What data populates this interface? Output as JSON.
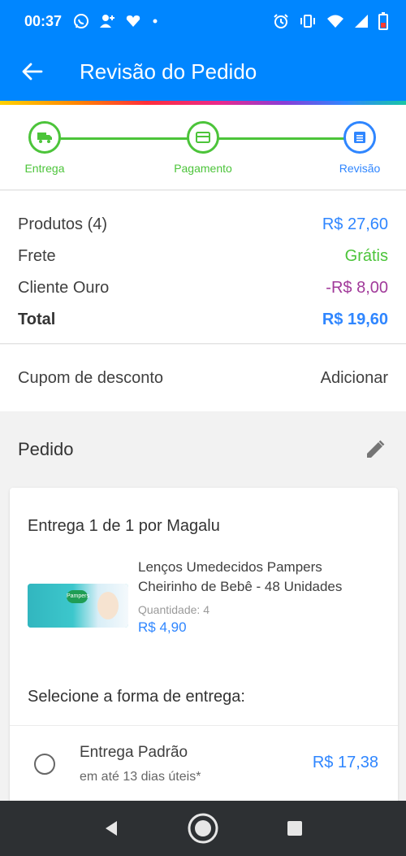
{
  "status_bar": {
    "time": "00:37",
    "left_icons": [
      "whatsapp-icon",
      "contacts-icon",
      "heart-icon",
      "dot-icon"
    ],
    "right_icons": [
      "alarm-icon",
      "vibrate-icon",
      "wifi-icon",
      "signal-icon",
      "battery-icon"
    ]
  },
  "app_bar": {
    "title": "Revisão do Pedido",
    "back_icon": "arrow-left-icon",
    "color": "#0086ff"
  },
  "stepper": {
    "steps": [
      {
        "label": "Entrega",
        "icon": "truck-icon",
        "state": "done"
      },
      {
        "label": "Pagamento",
        "icon": "card-icon",
        "state": "done"
      },
      {
        "label": "Revisão",
        "icon": "list-icon",
        "state": "active"
      }
    ],
    "done_color": "#4cc43a",
    "active_color": "#2f86ff"
  },
  "summary": {
    "products_label": "Produtos (4)",
    "products_value": "R$ 27,60",
    "shipping_label": "Frete",
    "shipping_value": "Grátis",
    "gold_label": "Cliente Ouro",
    "gold_value": "-R$ 8,00",
    "total_label": "Total",
    "total_value": "R$ 19,60"
  },
  "coupon": {
    "label": "Cupom de desconto",
    "action": "Adicionar"
  },
  "order": {
    "title": "Pedido",
    "edit_icon": "pencil-icon",
    "shipment_title": "Entrega 1 de 1 por Magalu",
    "product": {
      "name": "Lenços Umedecidos Pampers Cheirinho de Bebê - 48 Unidades",
      "quantity_label": "Quantidade:",
      "quantity": "4",
      "price": "R$ 4,90",
      "brand_mark": "Pampers"
    },
    "select_delivery_label": "Selecione a forma de entrega:",
    "delivery_option": {
      "name": "Entrega Padrão",
      "eta": "em até 13 dias úteis*",
      "price": "R$ 17,38",
      "selected": false
    }
  },
  "nav_bar": {
    "buttons": [
      "back-triangle-icon",
      "home-circle-icon",
      "recents-square-icon"
    ]
  }
}
